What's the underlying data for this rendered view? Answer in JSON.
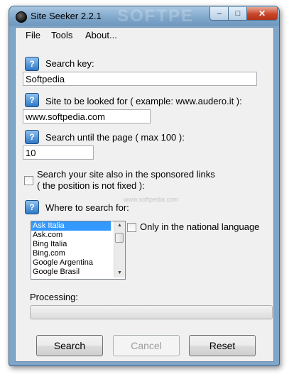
{
  "window": {
    "title": "Site Seeker 2.2.1",
    "watermark": "SOFTPE",
    "minimize_glyph": "–",
    "maximize_glyph": "□",
    "close_glyph": "✕"
  },
  "menu": {
    "file": "File",
    "tools": "Tools",
    "about": "About..."
  },
  "help_glyph": "?",
  "search_key": {
    "label": "Search key:",
    "value": "Softpedia"
  },
  "site": {
    "label": "Site to be looked for ( example: www.audero.it ):",
    "value": "www.softpedia.com"
  },
  "page_limit": {
    "label": "Search until the page ( max 100 ):",
    "value": "10"
  },
  "sponsored": {
    "label_line1": "Search your site also in the sponsored links",
    "label_line2": "( the position is not fixed ):",
    "checked": false,
    "watermark": "www.softpedia.com"
  },
  "where": {
    "label": "Where to search for:",
    "engines": [
      "Ask Italia",
      "Ask.com",
      "Bing Italia",
      "Bing.com",
      "Google Argentina",
      "Google Brasil"
    ],
    "selected": "Ask Italia",
    "national_label": "Only in the national language",
    "national_checked": false
  },
  "processing": {
    "label": "Processing:",
    "progress": 0
  },
  "buttons": {
    "search": "Search",
    "cancel": "Cancel",
    "reset": "Reset"
  }
}
